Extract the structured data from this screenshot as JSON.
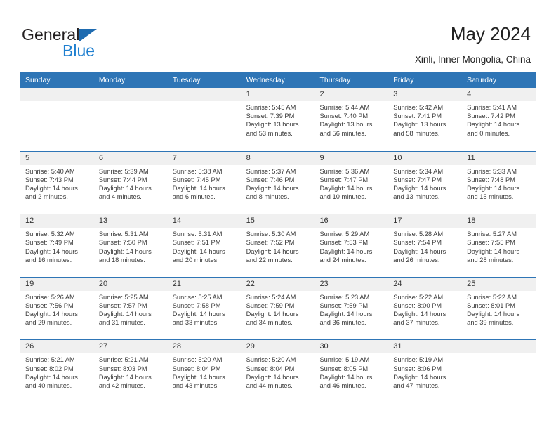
{
  "brand": {
    "name_part1": "General",
    "name_part2": "Blue",
    "accent_color": "#1e7fd0",
    "triangle_color": "#1e6bb0"
  },
  "header": {
    "title": "May 2024",
    "subtitle": "Xinli, Inner Mongolia, China"
  },
  "calendar": {
    "header_bg": "#2e75b6",
    "daynum_bg": "#f0f0f0",
    "weekdays": [
      "Sunday",
      "Monday",
      "Tuesday",
      "Wednesday",
      "Thursday",
      "Friday",
      "Saturday"
    ],
    "weeks": [
      [
        {
          "empty": true
        },
        {
          "empty": true
        },
        {
          "empty": true
        },
        {
          "day": "1",
          "sunrise": "Sunrise: 5:45 AM",
          "sunset": "Sunset: 7:39 PM",
          "daylight": "Daylight: 13 hours and 53 minutes."
        },
        {
          "day": "2",
          "sunrise": "Sunrise: 5:44 AM",
          "sunset": "Sunset: 7:40 PM",
          "daylight": "Daylight: 13 hours and 56 minutes."
        },
        {
          "day": "3",
          "sunrise": "Sunrise: 5:42 AM",
          "sunset": "Sunset: 7:41 PM",
          "daylight": "Daylight: 13 hours and 58 minutes."
        },
        {
          "day": "4",
          "sunrise": "Sunrise: 5:41 AM",
          "sunset": "Sunset: 7:42 PM",
          "daylight": "Daylight: 14 hours and 0 minutes."
        }
      ],
      [
        {
          "day": "5",
          "sunrise": "Sunrise: 5:40 AM",
          "sunset": "Sunset: 7:43 PM",
          "daylight": "Daylight: 14 hours and 2 minutes."
        },
        {
          "day": "6",
          "sunrise": "Sunrise: 5:39 AM",
          "sunset": "Sunset: 7:44 PM",
          "daylight": "Daylight: 14 hours and 4 minutes."
        },
        {
          "day": "7",
          "sunrise": "Sunrise: 5:38 AM",
          "sunset": "Sunset: 7:45 PM",
          "daylight": "Daylight: 14 hours and 6 minutes."
        },
        {
          "day": "8",
          "sunrise": "Sunrise: 5:37 AM",
          "sunset": "Sunset: 7:46 PM",
          "daylight": "Daylight: 14 hours and 8 minutes."
        },
        {
          "day": "9",
          "sunrise": "Sunrise: 5:36 AM",
          "sunset": "Sunset: 7:47 PM",
          "daylight": "Daylight: 14 hours and 10 minutes."
        },
        {
          "day": "10",
          "sunrise": "Sunrise: 5:34 AM",
          "sunset": "Sunset: 7:47 PM",
          "daylight": "Daylight: 14 hours and 13 minutes."
        },
        {
          "day": "11",
          "sunrise": "Sunrise: 5:33 AM",
          "sunset": "Sunset: 7:48 PM",
          "daylight": "Daylight: 14 hours and 15 minutes."
        }
      ],
      [
        {
          "day": "12",
          "sunrise": "Sunrise: 5:32 AM",
          "sunset": "Sunset: 7:49 PM",
          "daylight": "Daylight: 14 hours and 16 minutes."
        },
        {
          "day": "13",
          "sunrise": "Sunrise: 5:31 AM",
          "sunset": "Sunset: 7:50 PM",
          "daylight": "Daylight: 14 hours and 18 minutes."
        },
        {
          "day": "14",
          "sunrise": "Sunrise: 5:31 AM",
          "sunset": "Sunset: 7:51 PM",
          "daylight": "Daylight: 14 hours and 20 minutes."
        },
        {
          "day": "15",
          "sunrise": "Sunrise: 5:30 AM",
          "sunset": "Sunset: 7:52 PM",
          "daylight": "Daylight: 14 hours and 22 minutes."
        },
        {
          "day": "16",
          "sunrise": "Sunrise: 5:29 AM",
          "sunset": "Sunset: 7:53 PM",
          "daylight": "Daylight: 14 hours and 24 minutes."
        },
        {
          "day": "17",
          "sunrise": "Sunrise: 5:28 AM",
          "sunset": "Sunset: 7:54 PM",
          "daylight": "Daylight: 14 hours and 26 minutes."
        },
        {
          "day": "18",
          "sunrise": "Sunrise: 5:27 AM",
          "sunset": "Sunset: 7:55 PM",
          "daylight": "Daylight: 14 hours and 28 minutes."
        }
      ],
      [
        {
          "day": "19",
          "sunrise": "Sunrise: 5:26 AM",
          "sunset": "Sunset: 7:56 PM",
          "daylight": "Daylight: 14 hours and 29 minutes."
        },
        {
          "day": "20",
          "sunrise": "Sunrise: 5:25 AM",
          "sunset": "Sunset: 7:57 PM",
          "daylight": "Daylight: 14 hours and 31 minutes."
        },
        {
          "day": "21",
          "sunrise": "Sunrise: 5:25 AM",
          "sunset": "Sunset: 7:58 PM",
          "daylight": "Daylight: 14 hours and 33 minutes."
        },
        {
          "day": "22",
          "sunrise": "Sunrise: 5:24 AM",
          "sunset": "Sunset: 7:59 PM",
          "daylight": "Daylight: 14 hours and 34 minutes."
        },
        {
          "day": "23",
          "sunrise": "Sunrise: 5:23 AM",
          "sunset": "Sunset: 7:59 PM",
          "daylight": "Daylight: 14 hours and 36 minutes."
        },
        {
          "day": "24",
          "sunrise": "Sunrise: 5:22 AM",
          "sunset": "Sunset: 8:00 PM",
          "daylight": "Daylight: 14 hours and 37 minutes."
        },
        {
          "day": "25",
          "sunrise": "Sunrise: 5:22 AM",
          "sunset": "Sunset: 8:01 PM",
          "daylight": "Daylight: 14 hours and 39 minutes."
        }
      ],
      [
        {
          "day": "26",
          "sunrise": "Sunrise: 5:21 AM",
          "sunset": "Sunset: 8:02 PM",
          "daylight": "Daylight: 14 hours and 40 minutes."
        },
        {
          "day": "27",
          "sunrise": "Sunrise: 5:21 AM",
          "sunset": "Sunset: 8:03 PM",
          "daylight": "Daylight: 14 hours and 42 minutes."
        },
        {
          "day": "28",
          "sunrise": "Sunrise: 5:20 AM",
          "sunset": "Sunset: 8:04 PM",
          "daylight": "Daylight: 14 hours and 43 minutes."
        },
        {
          "day": "29",
          "sunrise": "Sunrise: 5:20 AM",
          "sunset": "Sunset: 8:04 PM",
          "daylight": "Daylight: 14 hours and 44 minutes."
        },
        {
          "day": "30",
          "sunrise": "Sunrise: 5:19 AM",
          "sunset": "Sunset: 8:05 PM",
          "daylight": "Daylight: 14 hours and 46 minutes."
        },
        {
          "day": "31",
          "sunrise": "Sunrise: 5:19 AM",
          "sunset": "Sunset: 8:06 PM",
          "daylight": "Daylight: 14 hours and 47 minutes."
        },
        {
          "empty": true
        }
      ]
    ]
  }
}
